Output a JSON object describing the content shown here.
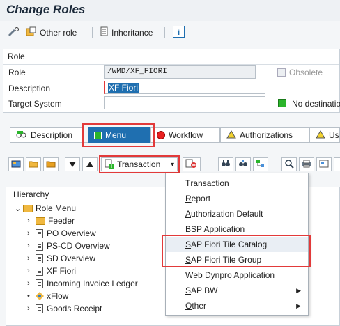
{
  "window": {
    "title": "Change Roles"
  },
  "toolbar": {
    "other_role": "Other role",
    "inheritance": "Inheritance",
    "info": "i"
  },
  "role_section": {
    "heading": "Role",
    "role_label": "Role",
    "role_value": "/WMD/XF_FIORI",
    "obsolete_label": "Obsolete",
    "description_label": "Description",
    "description_value": "XF Fiori",
    "target_label": "Target System",
    "target_value": "",
    "destination_text": "No destinatio"
  },
  "tabs": [
    {
      "label": "Description"
    },
    {
      "label": "Menu"
    },
    {
      "label": "Workflow"
    },
    {
      "label": "Authorizations"
    },
    {
      "label": "Us"
    }
  ],
  "menu_toolbar": {
    "transaction_label": "Transaction",
    "dropdown_arrow": "▾"
  },
  "hierarchy": {
    "heading": "Hierarchy",
    "root": "Role Menu",
    "items": [
      {
        "label": "Feeder"
      },
      {
        "label": "PO Overview"
      },
      {
        "label": "PS-CD Overview"
      },
      {
        "label": "SD Overview"
      },
      {
        "label": "XF Fiori"
      },
      {
        "label": "Incoming Invoice Ledger"
      },
      {
        "label": "xFlow"
      },
      {
        "label": "Goods Receipt"
      }
    ]
  },
  "dropdown": {
    "items": [
      {
        "first": "T",
        "rest": "ransaction"
      },
      {
        "first": "R",
        "rest": "eport"
      },
      {
        "first": "A",
        "rest": "uthorization Default"
      },
      {
        "first": "B",
        "rest": "SP Application"
      },
      {
        "first": "S",
        "rest": "AP Fiori Tile Catalog"
      },
      {
        "first": "S",
        "rest": "AP Fiori Tile Group"
      },
      {
        "first": "W",
        "rest": "eb Dynpro Application"
      },
      {
        "first": "S",
        "rest": "AP BW"
      },
      {
        "first": "O",
        "rest": "ther"
      }
    ],
    "submenu_arrow": "▶"
  },
  "colors": {
    "accent": "#1f6fb0",
    "highlight_box": "#e23a3a",
    "status_green": "#2bb52b",
    "warning_yellow": "#f2d22e"
  }
}
